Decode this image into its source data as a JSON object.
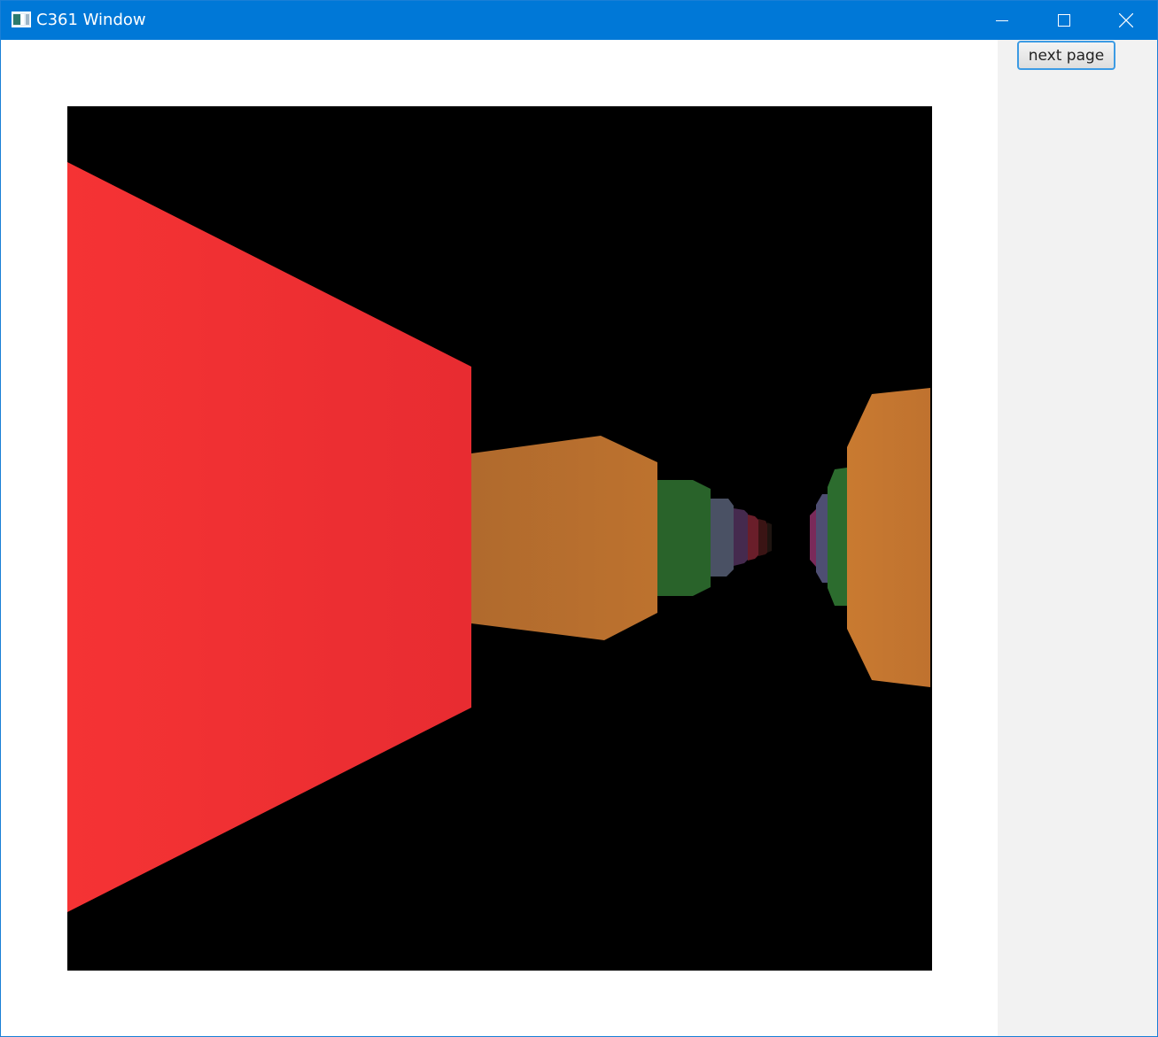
{
  "window": {
    "title": "C361 Window",
    "titlebar_color": "#0078d7",
    "controls": [
      "minimize-icon",
      "maximize-icon",
      "close-icon"
    ]
  },
  "side_panel": {
    "next_button_label": "next page"
  },
  "scene": {
    "background": "#000000",
    "left_wall_color": "#ef2f32",
    "orange_color": "#b8702e",
    "green_color": "#2a6a2a",
    "gray_color": "#4a5062",
    "purple_color": "#48284e",
    "red_color": "#6e1e28",
    "right_orange_color": "#c2742f"
  }
}
